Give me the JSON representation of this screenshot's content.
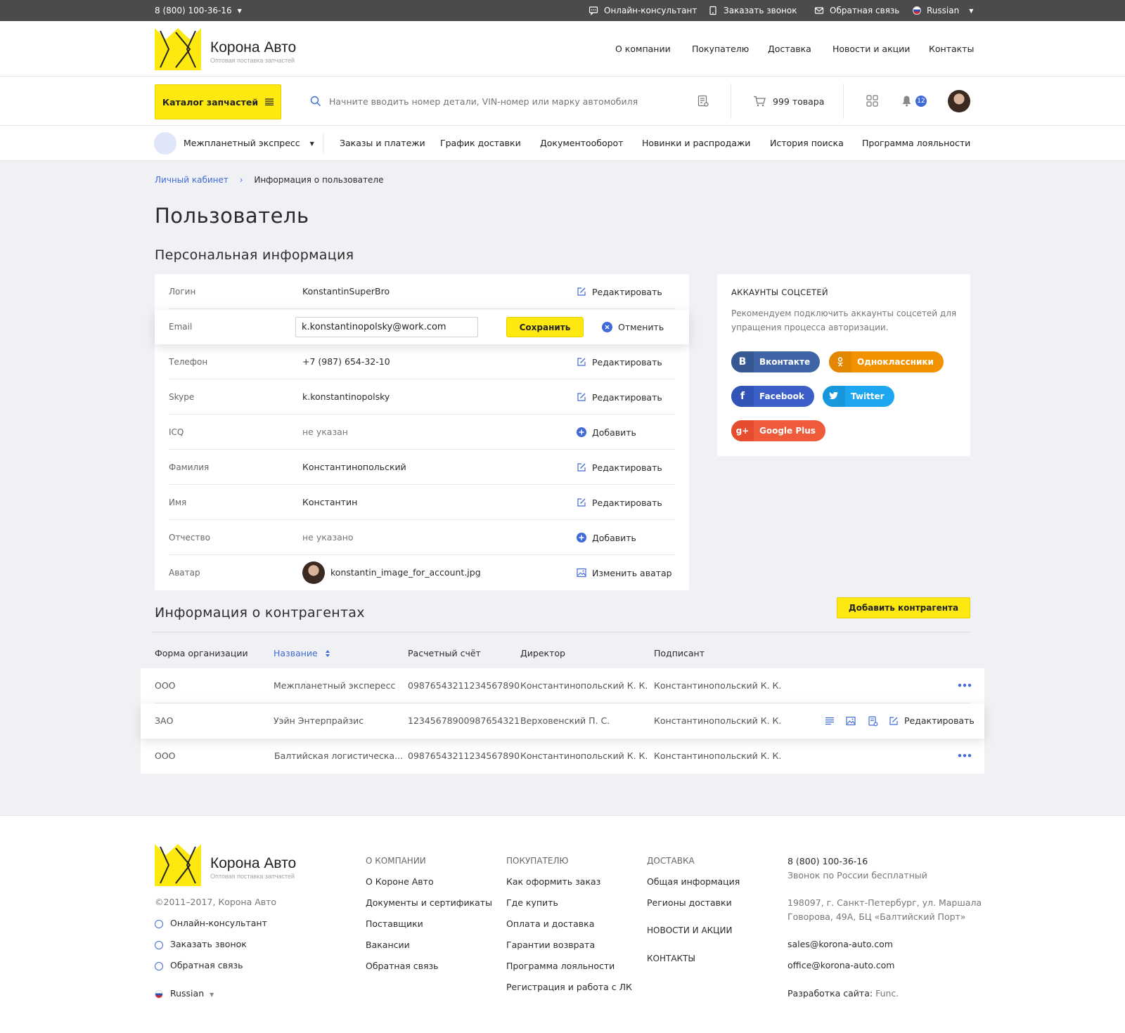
{
  "topbar": {
    "phone": "8 (800) 100-36-16",
    "online": "Онлайн-консультант",
    "callback": "Заказать звонок",
    "feedback": "Обратная связь",
    "language": "Russian"
  },
  "brand": {
    "name": "Корона Авто",
    "tagline": "Оптовая поставка запчастей"
  },
  "mainnav": [
    "О компании",
    "Покупателю",
    "Доставка",
    "Новости и акции",
    "Контакты"
  ],
  "toolbar": {
    "catalog": "Каталог запчастей",
    "search_placeholder": "Начните вводить номер детали, VIN-номер или марку автомобиля",
    "cart": "999 товара",
    "notifications": "12"
  },
  "subnav": {
    "company": "Межпланетный экспресс",
    "links": [
      "Заказы и платежи",
      "График доставки",
      "Документооборот",
      "Новинки и распродажи",
      "История поиска",
      "Программа лояльности"
    ]
  },
  "breadcrumb": {
    "root": "Личный кабинет",
    "sep": "›",
    "current": "Информация о пользователе"
  },
  "page": {
    "title": "Пользователь",
    "personal_title": "Персональная информация",
    "counterparts_title": "Информация о контрагентах",
    "add_counterpart": "Добавить контрагента"
  },
  "personal": {
    "rows": [
      {
        "label": "Логин",
        "value": "KonstantinSuperBro",
        "action": "Редактировать"
      },
      {
        "label": "Телефон",
        "value": "+7 (987) 654-32-10",
        "action": "Редактировать"
      },
      {
        "label": "Skype",
        "value": "k.konstantinopolsky",
        "action": "Редактировать"
      },
      {
        "label": "ICQ",
        "value": "не указан",
        "action": "Добавить"
      },
      {
        "label": "Фамилия",
        "value": "Константинопольский",
        "action": "Редактировать"
      },
      {
        "label": "Имя",
        "value": "Константин",
        "action": "Редактировать"
      },
      {
        "label": "Отчество",
        "value": "не указано",
        "action": "Добавить"
      },
      {
        "label": "Аватар",
        "value": "konstantin_image_for_account.jpg",
        "action": "Изменить аватар"
      }
    ],
    "email": {
      "label": "Email",
      "value": "k.konstantinopolsky@work.com",
      "save": "Сохранить",
      "cancel": "Отменить"
    }
  },
  "social": {
    "title": "АККАУНТЫ СОЦСЕТЕЙ",
    "text": "Рекомендуем подключить аккаунты соцсетей для упращения процесса авторизации.",
    "buttons": [
      {
        "name": "Вконтакте",
        "icon": "В",
        "color": "#3f65a8"
      },
      {
        "name": "Одноклассники",
        "icon": "ok",
        "color": "#f39200"
      },
      {
        "name": "Facebook",
        "icon": "f",
        "color": "#3b5ec9"
      },
      {
        "name": "Twitter",
        "icon": "tw",
        "color": "#1da7f0"
      },
      {
        "name": "Google Plus",
        "icon": "g+",
        "color": "#ef5a3a"
      }
    ]
  },
  "table": {
    "headers": [
      "Форма организации",
      "Название",
      "Расчетный счёт",
      "Директор",
      "Подписант"
    ],
    "rows": [
      [
        "ООО",
        "Межпланетный экспересс",
        "09876543211234567890",
        "Константинопольский К. К.",
        "Константинопольский К. К."
      ],
      [
        "ЗАО",
        "Уэйн Энтерпрайзис",
        "12345678900987654321",
        "Верховенский П. С.",
        "Константинопольский К. К."
      ],
      [
        "ООО",
        "Балтийская логистическа...",
        "09876543211234567890",
        "Константинопольский К. К.",
        "Константинопольский К. К."
      ]
    ],
    "row_edit": "Редактировать",
    "more": "•••"
  },
  "footer": {
    "copyright": "©2011–2017, Корона Авто",
    "links_left": [
      "Онлайн-консультант",
      "Заказать звонок",
      "Обратная связь"
    ],
    "language": "Russian",
    "col1": {
      "title": "О КОМПАНИИ",
      "items": [
        "О Короне Авто",
        "Документы и сертификаты",
        "Поставщики",
        "Вакансии",
        "Обратная связь"
      ]
    },
    "col2": {
      "title": "ПОКУПАТЕЛЮ",
      "items": [
        "Как оформить заказ",
        "Где купить",
        "Оплата и доставка",
        "Гарантии возврата",
        "Программа лояльности",
        "Регистрация и работа с ЛК"
      ]
    },
    "col3": {
      "title": "ДОСТАВКА",
      "items": [
        "Общая информация",
        "Регионы доставки"
      ],
      "news": "НОВОСТИ И АКЦИИ",
      "contacts": "КОНТАКТЫ"
    },
    "contact": {
      "phone": "8 (800) 100-36-16",
      "phone_note": "Звонок по России бесплатный",
      "address1": "198097, г. Санкт-Петербург, ул. Маршала",
      "address2": "Говорова, 49А, БЦ «Балтийский Порт»",
      "email1": "sales@korona-auto.com",
      "email2": "office@korona-auto.com",
      "dev_label": "Разработка сайта:",
      "dev_name": "Func."
    }
  },
  "colors": {
    "accent": "#fde910",
    "link": "#3f6ad8"
  }
}
